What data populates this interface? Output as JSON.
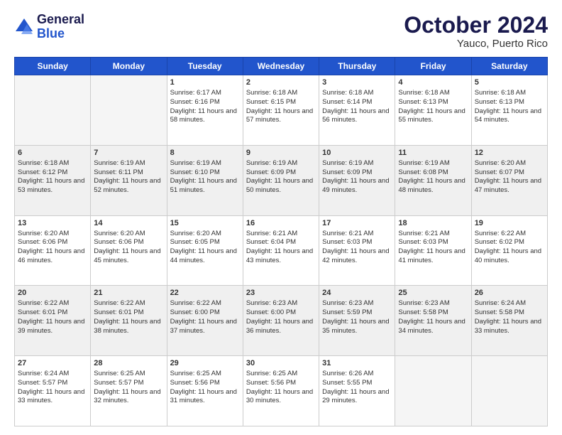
{
  "logo": {
    "line1": "General",
    "line2": "Blue"
  },
  "header": {
    "month": "October 2024",
    "location": "Yauco, Puerto Rico"
  },
  "weekdays": [
    "Sunday",
    "Monday",
    "Tuesday",
    "Wednesday",
    "Thursday",
    "Friday",
    "Saturday"
  ],
  "weeks": [
    [
      {
        "day": "",
        "info": ""
      },
      {
        "day": "",
        "info": ""
      },
      {
        "day": "1",
        "info": "Sunrise: 6:17 AM\nSunset: 6:16 PM\nDaylight: 11 hours and 58 minutes."
      },
      {
        "day": "2",
        "info": "Sunrise: 6:18 AM\nSunset: 6:15 PM\nDaylight: 11 hours and 57 minutes."
      },
      {
        "day": "3",
        "info": "Sunrise: 6:18 AM\nSunset: 6:14 PM\nDaylight: 11 hours and 56 minutes."
      },
      {
        "day": "4",
        "info": "Sunrise: 6:18 AM\nSunset: 6:13 PM\nDaylight: 11 hours and 55 minutes."
      },
      {
        "day": "5",
        "info": "Sunrise: 6:18 AM\nSunset: 6:13 PM\nDaylight: 11 hours and 54 minutes."
      }
    ],
    [
      {
        "day": "6",
        "info": "Sunrise: 6:18 AM\nSunset: 6:12 PM\nDaylight: 11 hours and 53 minutes."
      },
      {
        "day": "7",
        "info": "Sunrise: 6:19 AM\nSunset: 6:11 PM\nDaylight: 11 hours and 52 minutes."
      },
      {
        "day": "8",
        "info": "Sunrise: 6:19 AM\nSunset: 6:10 PM\nDaylight: 11 hours and 51 minutes."
      },
      {
        "day": "9",
        "info": "Sunrise: 6:19 AM\nSunset: 6:09 PM\nDaylight: 11 hours and 50 minutes."
      },
      {
        "day": "10",
        "info": "Sunrise: 6:19 AM\nSunset: 6:09 PM\nDaylight: 11 hours and 49 minutes."
      },
      {
        "day": "11",
        "info": "Sunrise: 6:19 AM\nSunset: 6:08 PM\nDaylight: 11 hours and 48 minutes."
      },
      {
        "day": "12",
        "info": "Sunrise: 6:20 AM\nSunset: 6:07 PM\nDaylight: 11 hours and 47 minutes."
      }
    ],
    [
      {
        "day": "13",
        "info": "Sunrise: 6:20 AM\nSunset: 6:06 PM\nDaylight: 11 hours and 46 minutes."
      },
      {
        "day": "14",
        "info": "Sunrise: 6:20 AM\nSunset: 6:06 PM\nDaylight: 11 hours and 45 minutes."
      },
      {
        "day": "15",
        "info": "Sunrise: 6:20 AM\nSunset: 6:05 PM\nDaylight: 11 hours and 44 minutes."
      },
      {
        "day": "16",
        "info": "Sunrise: 6:21 AM\nSunset: 6:04 PM\nDaylight: 11 hours and 43 minutes."
      },
      {
        "day": "17",
        "info": "Sunrise: 6:21 AM\nSunset: 6:03 PM\nDaylight: 11 hours and 42 minutes."
      },
      {
        "day": "18",
        "info": "Sunrise: 6:21 AM\nSunset: 6:03 PM\nDaylight: 11 hours and 41 minutes."
      },
      {
        "day": "19",
        "info": "Sunrise: 6:22 AM\nSunset: 6:02 PM\nDaylight: 11 hours and 40 minutes."
      }
    ],
    [
      {
        "day": "20",
        "info": "Sunrise: 6:22 AM\nSunset: 6:01 PM\nDaylight: 11 hours and 39 minutes."
      },
      {
        "day": "21",
        "info": "Sunrise: 6:22 AM\nSunset: 6:01 PM\nDaylight: 11 hours and 38 minutes."
      },
      {
        "day": "22",
        "info": "Sunrise: 6:22 AM\nSunset: 6:00 PM\nDaylight: 11 hours and 37 minutes."
      },
      {
        "day": "23",
        "info": "Sunrise: 6:23 AM\nSunset: 6:00 PM\nDaylight: 11 hours and 36 minutes."
      },
      {
        "day": "24",
        "info": "Sunrise: 6:23 AM\nSunset: 5:59 PM\nDaylight: 11 hours and 35 minutes."
      },
      {
        "day": "25",
        "info": "Sunrise: 6:23 AM\nSunset: 5:58 PM\nDaylight: 11 hours and 34 minutes."
      },
      {
        "day": "26",
        "info": "Sunrise: 6:24 AM\nSunset: 5:58 PM\nDaylight: 11 hours and 33 minutes."
      }
    ],
    [
      {
        "day": "27",
        "info": "Sunrise: 6:24 AM\nSunset: 5:57 PM\nDaylight: 11 hours and 33 minutes."
      },
      {
        "day": "28",
        "info": "Sunrise: 6:25 AM\nSunset: 5:57 PM\nDaylight: 11 hours and 32 minutes."
      },
      {
        "day": "29",
        "info": "Sunrise: 6:25 AM\nSunset: 5:56 PM\nDaylight: 11 hours and 31 minutes."
      },
      {
        "day": "30",
        "info": "Sunrise: 6:25 AM\nSunset: 5:56 PM\nDaylight: 11 hours and 30 minutes."
      },
      {
        "day": "31",
        "info": "Sunrise: 6:26 AM\nSunset: 5:55 PM\nDaylight: 11 hours and 29 minutes."
      },
      {
        "day": "",
        "info": ""
      },
      {
        "day": "",
        "info": ""
      }
    ]
  ]
}
